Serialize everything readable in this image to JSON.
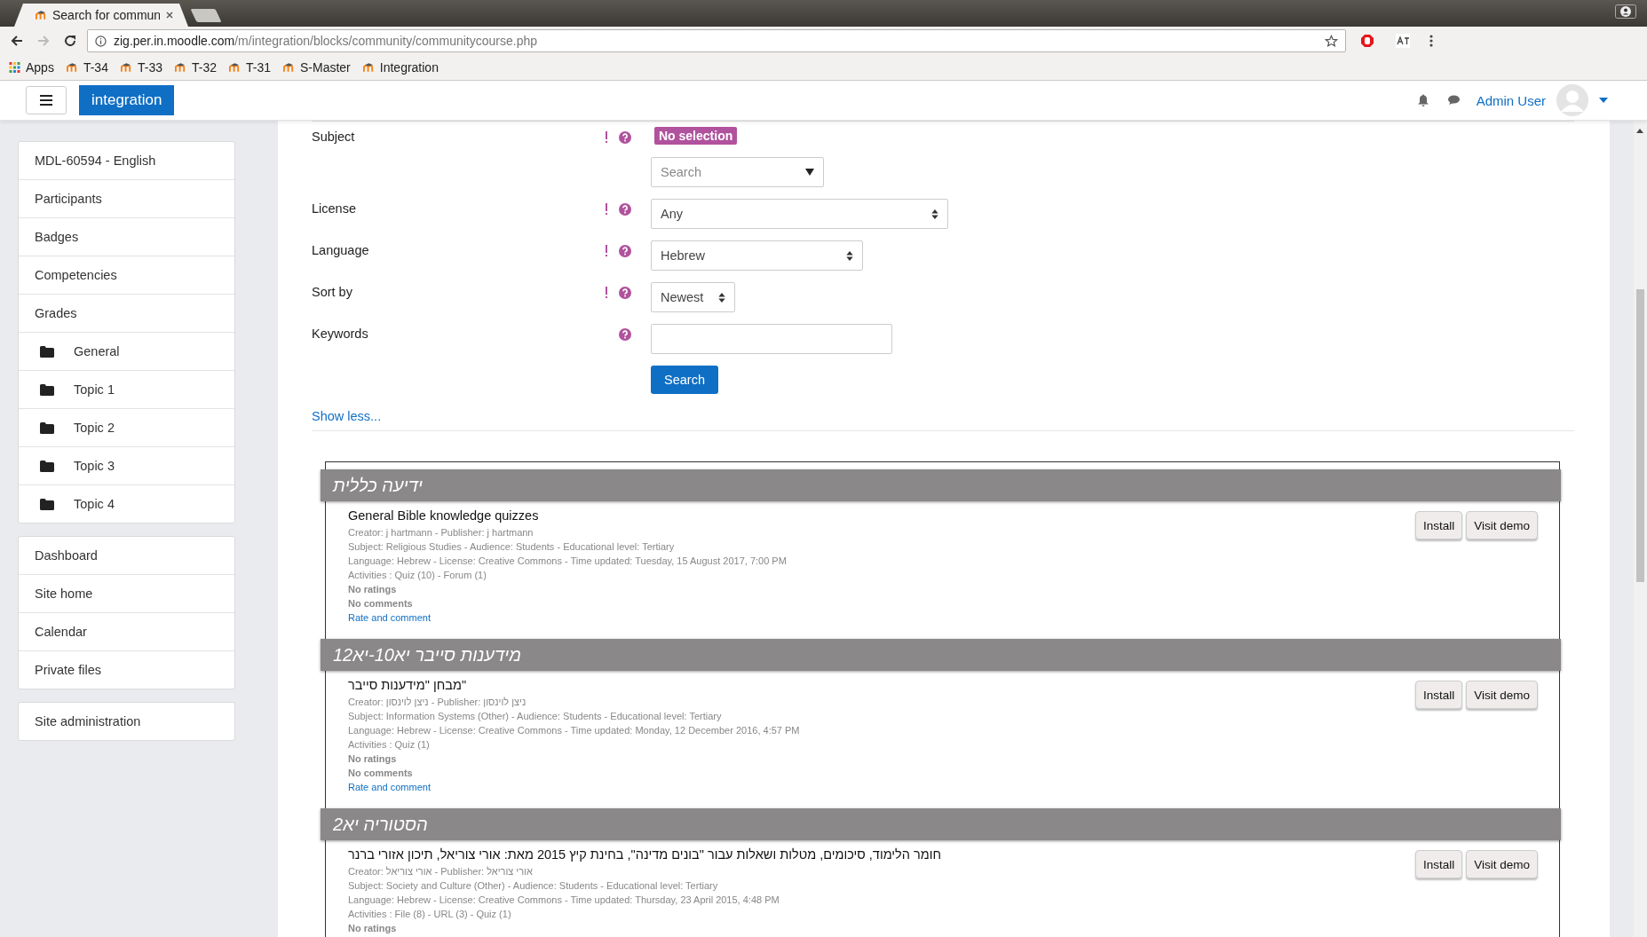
{
  "browser": {
    "tab_title": "Search for commun",
    "url_host": "zig.per.in.moodle.com",
    "url_path": "/m/integration/blocks/community/communitycourse.php",
    "bookmarks": [
      {
        "label": "Apps",
        "kind": "apps"
      },
      {
        "label": "T-34",
        "kind": "site"
      },
      {
        "label": "T-33",
        "kind": "site"
      },
      {
        "label": "T-32",
        "kind": "site"
      },
      {
        "label": "T-31",
        "kind": "site"
      },
      {
        "label": "S-Master",
        "kind": "site"
      },
      {
        "label": "Integration",
        "kind": "site"
      }
    ]
  },
  "navbar": {
    "site_name": "integration",
    "user_name": "Admin User"
  },
  "sidebar": {
    "groups": [
      [
        {
          "label": "MDL-60594 - English",
          "kind": "link"
        },
        {
          "label": "Participants",
          "kind": "link"
        },
        {
          "label": "Badges",
          "kind": "link"
        },
        {
          "label": "Competencies",
          "kind": "link"
        },
        {
          "label": "Grades",
          "kind": "link"
        },
        {
          "label": "General",
          "kind": "section"
        },
        {
          "label": "Topic 1",
          "kind": "section"
        },
        {
          "label": "Topic 2",
          "kind": "section"
        },
        {
          "label": "Topic 3",
          "kind": "section"
        },
        {
          "label": "Topic 4",
          "kind": "section"
        }
      ],
      [
        {
          "label": "Dashboard",
          "kind": "link"
        },
        {
          "label": "Site home",
          "kind": "link"
        },
        {
          "label": "Calendar",
          "kind": "link"
        },
        {
          "label": "Private files",
          "kind": "link"
        }
      ],
      [
        {
          "label": "Site administration",
          "kind": "link"
        }
      ]
    ]
  },
  "form": {
    "fields": [
      {
        "label": "Subject",
        "advanced": true,
        "kind": "autocomplete",
        "badge": "No selection",
        "placeholder": "Search"
      },
      {
        "label": "License",
        "advanced": true,
        "kind": "select",
        "value": "Any"
      },
      {
        "label": "Language",
        "advanced": true,
        "kind": "select",
        "value": "Hebrew"
      },
      {
        "label": "Sort by",
        "advanced": true,
        "kind": "select",
        "value": "Newest"
      },
      {
        "label": "Keywords",
        "advanced": false,
        "kind": "text"
      }
    ],
    "submit": "Search",
    "toggle_link": "Show less..."
  },
  "results": [
    {
      "heading": "ידיעה כללית",
      "title": "General Bible knowledge quizzes",
      "details": [
        "Creator: j hartmann - Publisher: j hartmann",
        "Subject: Religious Studies - Audience: Students - Educational level: Tertiary",
        "Language: Hebrew - License: Creative Commons - Time updated: Tuesday, 15 August 2017, 7:00 PM",
        "Activities : Quiz (10) - Forum (1)"
      ],
      "ratings": "No ratings",
      "comments": "No comments",
      "link": "Rate and comment",
      "buttons": [
        "Install",
        "Visit demo"
      ]
    },
    {
      "heading": "מידענות סייבר יא10-יא12",
      "title": "מבחן \"מידענות סייבר\"",
      "details": [
        "Creator: ניצן לוינסון - Publisher: ניצן לוינסון",
        "Subject: Information Systems (Other) - Audience: Students - Educational level: Tertiary",
        "Language: Hebrew - License: Creative Commons - Time updated: Monday, 12 December 2016, 4:57 PM",
        "Activities : Quiz (1)"
      ],
      "ratings": "No ratings",
      "comments": "No comments",
      "link": "Rate and comment",
      "buttons": [
        "Install",
        "Visit demo"
      ]
    },
    {
      "heading": "הסטוריה יא2",
      "title": "חומר הלימוד, סיכומים, מטלות ושאלות עבור \"בונים מדינה\", בחינת קיץ 2015 מאת: אורי צוריאל, תיכון אזורי ברנר",
      "details": [
        "Creator: אורי צוריאל - Publisher: אורי צוריאל",
        "Subject: Society and Culture (Other) - Audience: Students - Educational level: Tertiary",
        "Language: Hebrew - License: Creative Commons - Time updated: Thursday, 23 April 2015, 4:48 PM",
        "Activities : File (8) - URL (3) - Quiz (1)"
      ],
      "ratings": "No ratings",
      "buttons": [
        "Install",
        "Visit demo"
      ]
    }
  ]
}
